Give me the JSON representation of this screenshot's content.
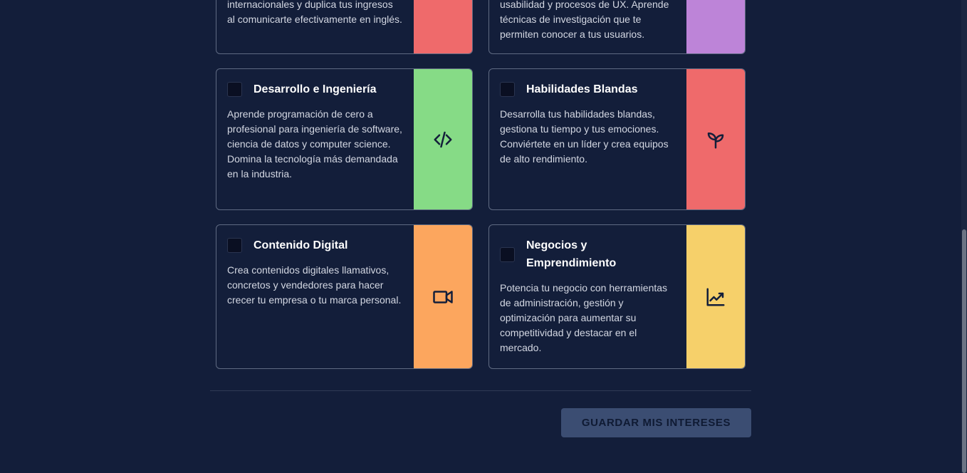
{
  "cards": [
    {
      "title": "",
      "description": "internacionales y duplica tus ingresos al comunicarte efectivamente en inglés.",
      "color": "#ef6a6b",
      "icon": "partial-icon"
    },
    {
      "title": "",
      "description": "usabilidad y procesos de UX. Aprende técnicas de investigación que te permiten conocer a tus usuarios.",
      "color": "#bd84d8",
      "icon": "partial-icon"
    },
    {
      "title": "Desarrollo e Ingeniería",
      "description": "Aprende programación de cero a profesional para ingeniería de software, ciencia de datos y computer science. Domina la tecnología más demandada en la industria.",
      "color": "#86db86",
      "icon": "code-icon"
    },
    {
      "title": "Habilidades Blandas",
      "description": "Desarrolla tus habilidades blandas, gestiona tu tiempo y tus emociones. Conviértete en un líder y crea equipos de alto rendimiento.",
      "color": "#ef6a6b",
      "icon": "sprout-icon"
    },
    {
      "title": "Contenido Digital",
      "description": "Crea contenidos digitales llamativos, concretos y vendedores para hacer crecer tu empresa o tu marca personal.",
      "color": "#fca65e",
      "icon": "video-camera-icon"
    },
    {
      "title": "Negocios y Emprendimiento",
      "description": "Potencia tu negocio con herramientas de administración, gestión y optimización para aumentar su competitividad y destacar en el mercado.",
      "color": "#f6d06a",
      "icon": "trending-up-chart-icon"
    }
  ],
  "save_button": {
    "label": "GUARDAR MIS INTERESES"
  }
}
